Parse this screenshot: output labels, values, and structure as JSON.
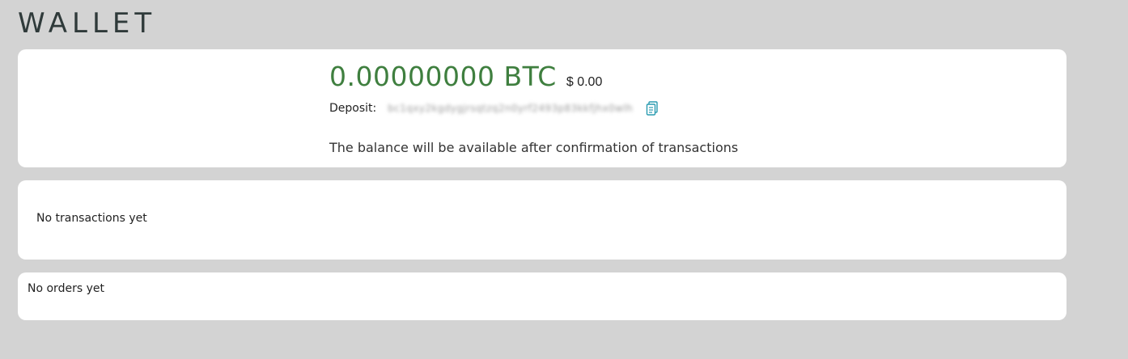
{
  "page": {
    "title": "WALLET"
  },
  "wallet": {
    "btc_balance": "0.00000000 BTC",
    "usd_balance": "$ 0.00",
    "deposit_label": "Deposit:",
    "deposit_address": "bc1qxy2kgdygjrsqtzq2n0yrf2493p83kkfjhx0wlh",
    "copy_icon": "copy-icon",
    "balance_note": "The balance will be available after confirmation of transactions"
  },
  "transactions": {
    "empty_text": "No transactions yet"
  },
  "orders": {
    "empty_text": "No orders yet"
  },
  "colors": {
    "background": "#d3d3d3",
    "card": "#ffffff",
    "balance_green": "#3f7f3f",
    "accent_teal": "#2a9bb0"
  }
}
